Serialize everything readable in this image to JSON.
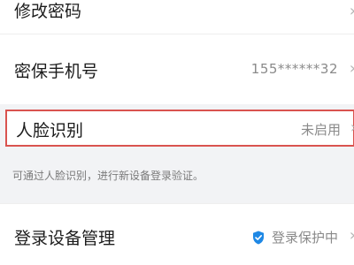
{
  "security_settings": {
    "change_password": {
      "label": "修改密码",
      "chevron": "›"
    },
    "security_phone": {
      "label": "密保手机号",
      "value": "155******32",
      "chevron": "›"
    },
    "face_recognition": {
      "label": "人脸识别",
      "status": "未启用",
      "chevron": "›",
      "highlight_color": "#d9534f"
    },
    "face_recognition_hint": "可通过人脸识别，进行新设备登录验证。",
    "device_management": {
      "label": "登录设备管理",
      "status": "登录保护中",
      "icon": "shield-check-icon",
      "icon_color": "#1e88e5",
      "chevron": "›"
    }
  }
}
